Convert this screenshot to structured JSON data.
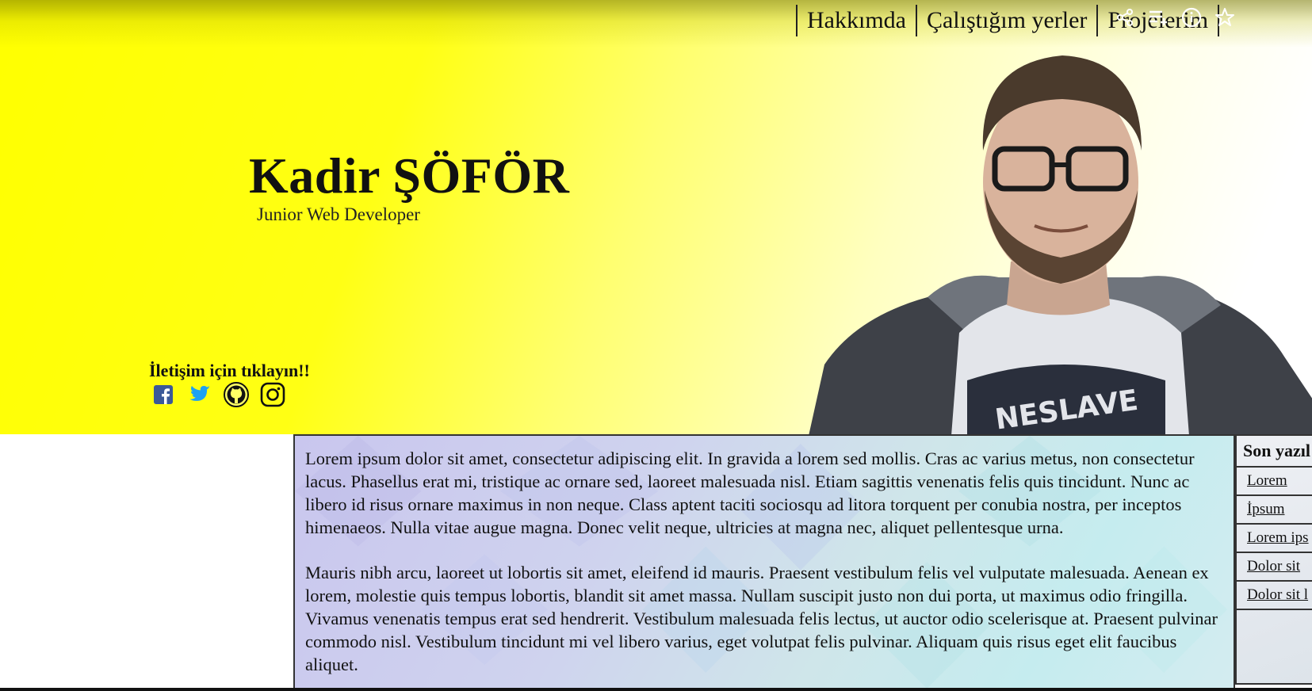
{
  "nav": {
    "items": [
      {
        "label": "Hakkımda"
      },
      {
        "label": "Çalıştığım yerler"
      },
      {
        "label": "Projelerim"
      }
    ]
  },
  "browser_icons": [
    "share-icon",
    "playlist-icon",
    "info-icon",
    "star-icon"
  ],
  "hero": {
    "name": "Kadir ŞÖFÖR",
    "role": "Junior Web Developer",
    "contact_title": "İletişim için tıklayın!!",
    "social": [
      {
        "icon": "facebook-icon",
        "color": "#3b5998"
      },
      {
        "icon": "twitter-icon",
        "color": "#1da1f2"
      },
      {
        "icon": "github-icon",
        "color": "#111111"
      },
      {
        "icon": "instagram-icon",
        "color": "#111111"
      }
    ]
  },
  "colors": {
    "hero_yellow": "#ffff00",
    "content_bg": "#cfe0ee",
    "border": "#333333"
  },
  "content": {
    "paragraphs": [
      "Lorem ipsum dolor sit amet, consectetur adipiscing elit. In gravida a lorem sed mollis. Cras ac varius metus, non consectetur lacus. Phasellus erat mi, tristique ac ornare sed, laoreet malesuada nisl. Etiam sagittis venenatis felis quis tincidunt. Nunc ac libero id risus ornare maximus in non neque. Class aptent taciti sociosqu ad litora torquent per conubia nostra, per inceptos himenaeos. Nulla vitae augue magna. Donec velit neque, ultricies at magna nec, aliquet pellentesque urna.",
      "Mauris nibh arcu, laoreet ut lobortis sit amet, eleifend id mauris. Praesent vestibulum felis vel vulputate malesuada. Aenean ex lorem, molestie quis tempus lobortis, blandit sit amet massa. Nullam suscipit justo non dui porta, ut maximus odio fringilla. Vivamus venenatis tempus erat sed hendrerit. Vestibulum malesuada felis lectus, ut auctor odio scelerisque at. Praesent pulvinar commodo nisl. Vestibulum tincidunt mi vel libero varius, eget volutpat felis pulvinar. Aliquam quis risus eget elit faucibus aliquet."
    ]
  },
  "sidebar": {
    "title": "Son yazıl",
    "items": [
      {
        "label": "Lorem"
      },
      {
        "label": "İpsum"
      },
      {
        "label": "Lorem ips"
      },
      {
        "label": "Dolor sit"
      },
      {
        "label": "Dolor sit l"
      }
    ]
  }
}
